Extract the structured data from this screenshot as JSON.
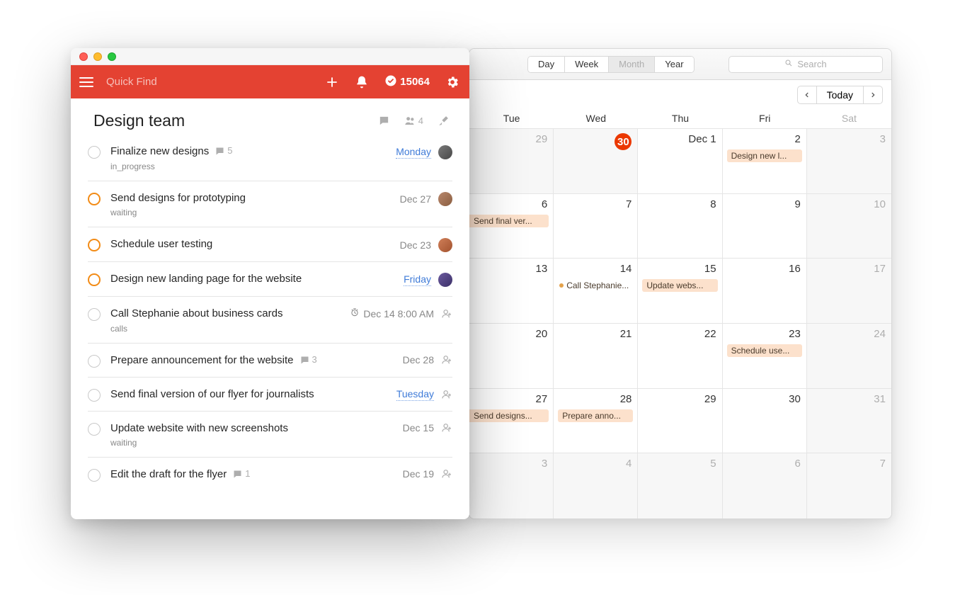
{
  "calendar": {
    "views": [
      "Day",
      "Week",
      "Month",
      "Year"
    ],
    "active_view_index": 2,
    "search_placeholder": "Search",
    "today_label": "Today",
    "dow": [
      "Tue",
      "Wed",
      "Thu",
      "Fri",
      "Sat"
    ],
    "weeks": [
      [
        {
          "n": "29",
          "outside": true
        },
        {
          "n": "30",
          "today": true,
          "outside": true
        },
        {
          "n": "Dec 1"
        },
        {
          "n": "2",
          "events": [
            {
              "t": "Design new l...",
              "type": "block"
            }
          ]
        },
        {
          "n": "3",
          "outside": true
        }
      ],
      [
        {
          "n": "6",
          "events": [
            {
              "t": "Send final ver...",
              "type": "block-left"
            }
          ]
        },
        {
          "n": "7"
        },
        {
          "n": "8"
        },
        {
          "n": "9"
        },
        {
          "n": "10",
          "outside": true
        }
      ],
      [
        {
          "n": "13"
        },
        {
          "n": "14",
          "events": [
            {
              "t": "Call Stephanie...",
              "type": "dot"
            }
          ]
        },
        {
          "n": "15",
          "events": [
            {
              "t": "Update webs...",
              "type": "block"
            }
          ]
        },
        {
          "n": "16"
        },
        {
          "n": "17",
          "outside": true
        }
      ],
      [
        {
          "n": "20"
        },
        {
          "n": "21"
        },
        {
          "n": "22"
        },
        {
          "n": "23",
          "events": [
            {
              "t": "Schedule use...",
              "type": "block"
            }
          ]
        },
        {
          "n": "24",
          "outside": true
        }
      ],
      [
        {
          "n": "27",
          "events": [
            {
              "t": "Send designs...",
              "type": "block-left"
            }
          ]
        },
        {
          "n": "28",
          "events": [
            {
              "t": "Prepare anno...",
              "type": "block"
            }
          ]
        },
        {
          "n": "29"
        },
        {
          "n": "30"
        },
        {
          "n": "31",
          "outside": true
        }
      ],
      [
        {
          "n": "3",
          "outside": true
        },
        {
          "n": "4",
          "outside": true
        },
        {
          "n": "5",
          "outside": true
        },
        {
          "n": "6",
          "outside": true
        },
        {
          "n": "7",
          "outside": true
        }
      ]
    ]
  },
  "app": {
    "search_placeholder": "Quick Find",
    "karma": "15064",
    "project": {
      "title": "Design team",
      "people_count": "4"
    },
    "tasks": [
      {
        "title": "Finalize new designs",
        "comments": "5",
        "label": "in_progress",
        "date": "Monday",
        "date_style": "link",
        "avatar": "v4",
        "priority": ""
      },
      {
        "title": "Send designs for prototyping",
        "label": "waiting",
        "date": "Dec 27",
        "avatar": "",
        "priority": "p3"
      },
      {
        "title": "Schedule user testing",
        "date": "Dec 23",
        "avatar": "v3",
        "priority": "p3"
      },
      {
        "title": "Design new landing page for the website",
        "date": "Friday",
        "date_style": "link",
        "avatar": "v2",
        "priority": "p3"
      },
      {
        "title": "Call Stephanie about business cards",
        "label": "calls",
        "date": "Dec 14 8:00 AM",
        "has_clock": true,
        "assign": true,
        "priority": ""
      },
      {
        "title": "Prepare announcement for the website",
        "comments": "3",
        "date": "Dec 28",
        "assign": true,
        "priority": ""
      },
      {
        "title": "Send final version of our flyer for journalists",
        "date": "Tuesday",
        "date_style": "link",
        "assign": true,
        "priority": ""
      },
      {
        "title": "Update website with new screenshots",
        "label": "waiting",
        "date": "Dec 15",
        "assign": true,
        "priority": ""
      },
      {
        "title": "Edit the draft for the flyer",
        "comments": "1",
        "date": "Dec 19",
        "assign": true,
        "priority": ""
      }
    ]
  }
}
